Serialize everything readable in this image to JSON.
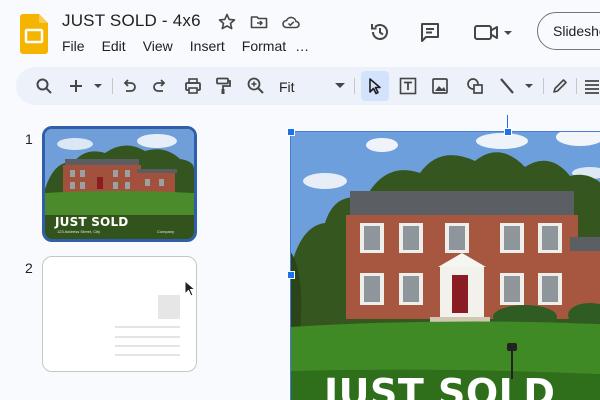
{
  "header": {
    "doc_title": "JUST SOLD - 4x6",
    "menus": [
      "File",
      "Edit",
      "View",
      "Insert",
      "Format",
      "…"
    ],
    "slideshow_label": "Slideshow"
  },
  "toolbar": {
    "zoom_value": "Fit",
    "active_tool": "select"
  },
  "filmstrip": {
    "slides": [
      {
        "number": "1",
        "thumb_title": "JUST SOLD",
        "thumb_footer_left": "123 Address Street, City",
        "thumb_footer_right": "Company"
      },
      {
        "number": "2"
      }
    ]
  },
  "canvas": {
    "title": "JUST SOLD"
  },
  "colors": {
    "accent": "#1a73e8",
    "app_background": "#f8fafd",
    "toolbar_background": "#edf2fa",
    "slides_logo": "#f4b400"
  }
}
